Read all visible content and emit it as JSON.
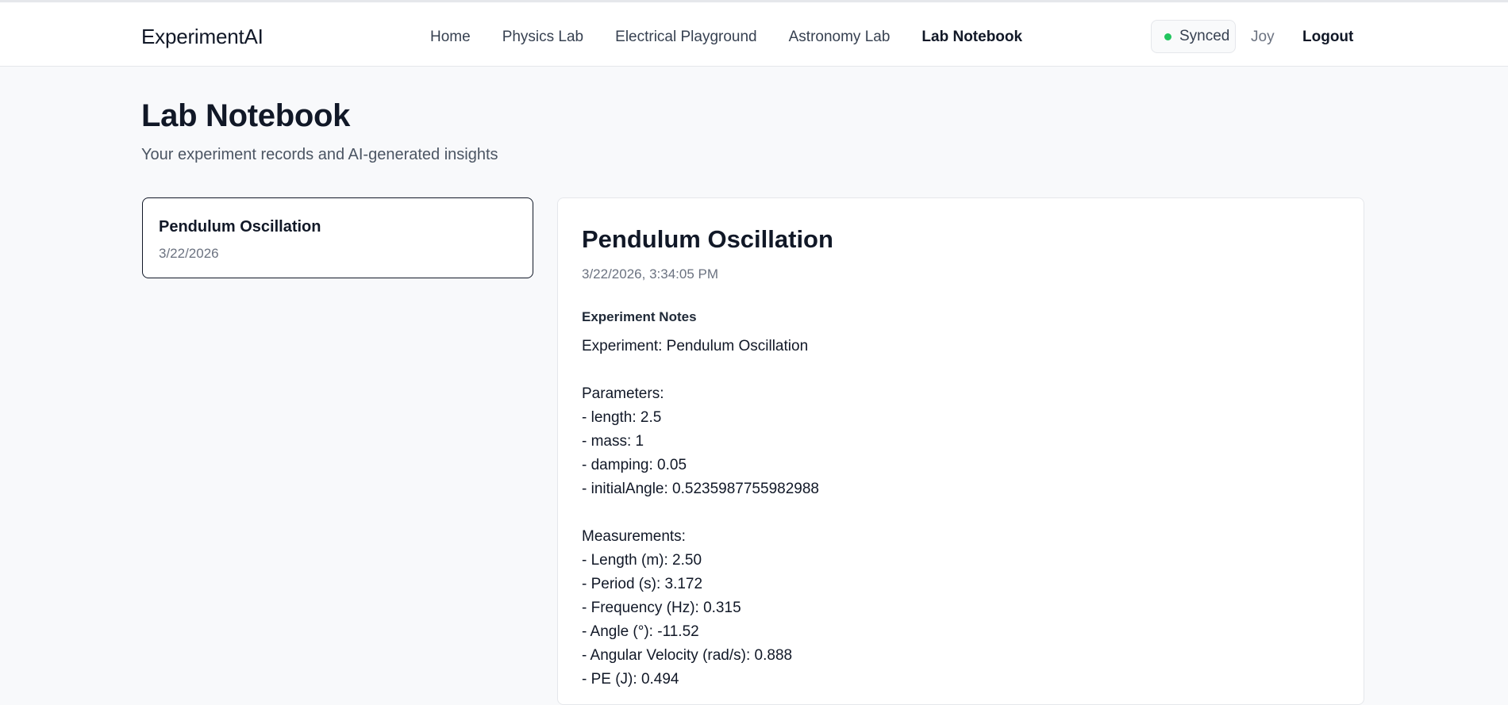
{
  "header": {
    "brand": "ExperimentAI",
    "nav": [
      {
        "label": "Home",
        "active": false
      },
      {
        "label": "Physics Lab",
        "active": false
      },
      {
        "label": "Electrical Playground",
        "active": false
      },
      {
        "label": "Astronomy Lab",
        "active": false
      },
      {
        "label": "Lab Notebook",
        "active": true
      }
    ],
    "sync_status": "Synced",
    "sync_color": "#22c55e",
    "user": "Joy",
    "logout_label": "Logout"
  },
  "page": {
    "title": "Lab Notebook",
    "subtitle": "Your experiment records and AI-generated insights"
  },
  "experiments": [
    {
      "title": "Pendulum Oscillation",
      "date": "3/22/2026"
    }
  ],
  "detail": {
    "title": "Pendulum Oscillation",
    "timestamp": "3/22/2026, 3:34:05 PM",
    "notes_label": "Experiment Notes",
    "notes_lines": [
      "Experiment: Pendulum Oscillation",
      "",
      "Parameters:",
      "- length: 2.5",
      "- mass: 1",
      "- damping: 0.05",
      "- initialAngle: 0.5235987755982988",
      "",
      "Measurements:",
      "- Length (m): 2.50",
      "- Period (s): 3.172",
      "- Frequency (Hz): 0.315",
      "- Angle (°): -11.52",
      "- Angular Velocity (rad/s): 0.888",
      "- PE (J): 0.494"
    ]
  }
}
